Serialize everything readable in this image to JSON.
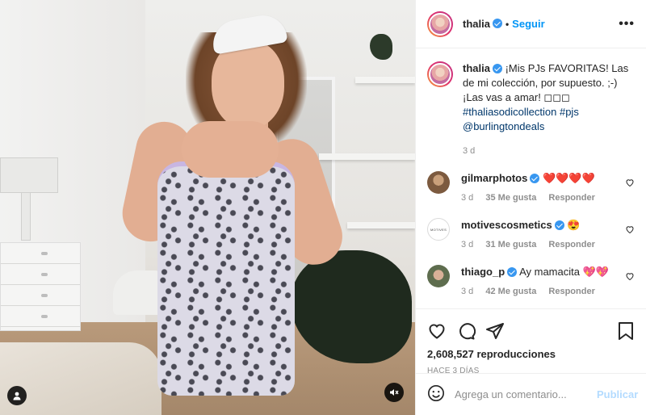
{
  "header": {
    "username": "thalia",
    "follow_label": "Seguir",
    "dot": "•",
    "more_icon": "more-horizontal-icon"
  },
  "caption": {
    "username": "thalia",
    "text_before": "¡Mis PJs FAVORITAS! Las de mi colección, por supuesto. ;-) ¡Las vas a amar! ◻◻◻",
    "hashtags": "#thaliasodicollection #pjs",
    "mention": "@burlingtondeals",
    "time": "3 d"
  },
  "comments": [
    {
      "username": "gilmarphotos",
      "text": "❤️❤️❤️❤️",
      "time": "3 d",
      "likes": "35 Me gusta",
      "reply": "Responder",
      "avatar_text": ""
    },
    {
      "username": "motivescosmetics",
      "text": "😍",
      "time": "3 d",
      "likes": "31 Me gusta",
      "reply": "Responder",
      "avatar_text": "MOTIVES"
    },
    {
      "username": "thiago_p",
      "text": "Ay mamacita 💖💖",
      "time": "3 d",
      "likes": "42 Me gusta",
      "reply": "Responder",
      "avatar_text": ""
    }
  ],
  "actions": {
    "views": "2,608,527 reproducciones",
    "posted_ago": "HACE 3 DÍAS"
  },
  "add_comment": {
    "placeholder": "Agrega un comentario...",
    "post_label": "Publicar"
  },
  "colors": {
    "link_blue": "#0095f6",
    "verified_blue": "#3897f0",
    "hashtag": "#00376b",
    "muted": "#8e8e8e",
    "post_disabled": "#b3dbff"
  }
}
